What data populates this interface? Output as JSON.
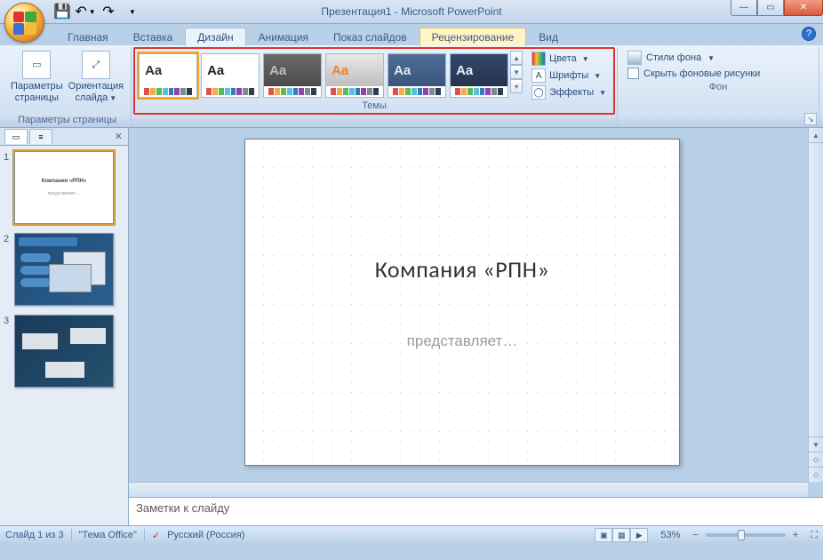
{
  "window": {
    "title": "Презентация1 - Microsoft PowerPoint"
  },
  "qat": {
    "save": "💾",
    "undo": "↶",
    "redo": "↷"
  },
  "tabs": {
    "items": [
      "Главная",
      "Вставка",
      "Дизайн",
      "Анимация",
      "Показ слайдов",
      "Рецензирование",
      "Вид"
    ],
    "active_index": 2,
    "highlight_index": 5
  },
  "ribbon": {
    "page_setup": {
      "label": "Параметры страницы",
      "btn1": "Параметры\nстраницы",
      "btn2": "Ориентация\nслайда"
    },
    "themes": {
      "label": "Темы",
      "items": [
        {
          "aa_color": "#333",
          "bg": "#ffffff",
          "selected": true
        },
        {
          "aa_color": "#222",
          "bg": "#ffffff",
          "selected": false
        },
        {
          "aa_color": "#bdbdbd",
          "bg": "linear-gradient(#6b6b6b,#4a4a4a)",
          "selected": false
        },
        {
          "aa_color": "#f07f2e",
          "bg": "linear-gradient(#e8e8e8,#bfbfbf)",
          "selected": false
        },
        {
          "aa_color": "#dfe9f4",
          "bg": "linear-gradient(#4e6e98,#3a557a)",
          "selected": false
        },
        {
          "aa_color": "#e8eef6",
          "bg": "linear-gradient(#33486a,#24344f)",
          "selected": false
        }
      ],
      "opts": {
        "colors": "Цвета",
        "fonts": "Шрифты",
        "effects": "Эффекты"
      }
    },
    "background": {
      "label": "Фон",
      "styles": "Стили фона",
      "hide": "Скрыть фоновые рисунки"
    }
  },
  "slides": {
    "count": 3,
    "current": 1,
    "thumb1": {
      "title": "Компания «РПН»",
      "sub": "представляет…"
    }
  },
  "canvas": {
    "title": "Компания «РПН»",
    "subtitle": "представляет…"
  },
  "notes": {
    "placeholder": "Заметки к слайду"
  },
  "status": {
    "slide": "Слайд 1 из 3",
    "theme": "\"Тема Office\"",
    "lang": "Русский (Россия)",
    "zoom": "53%"
  }
}
